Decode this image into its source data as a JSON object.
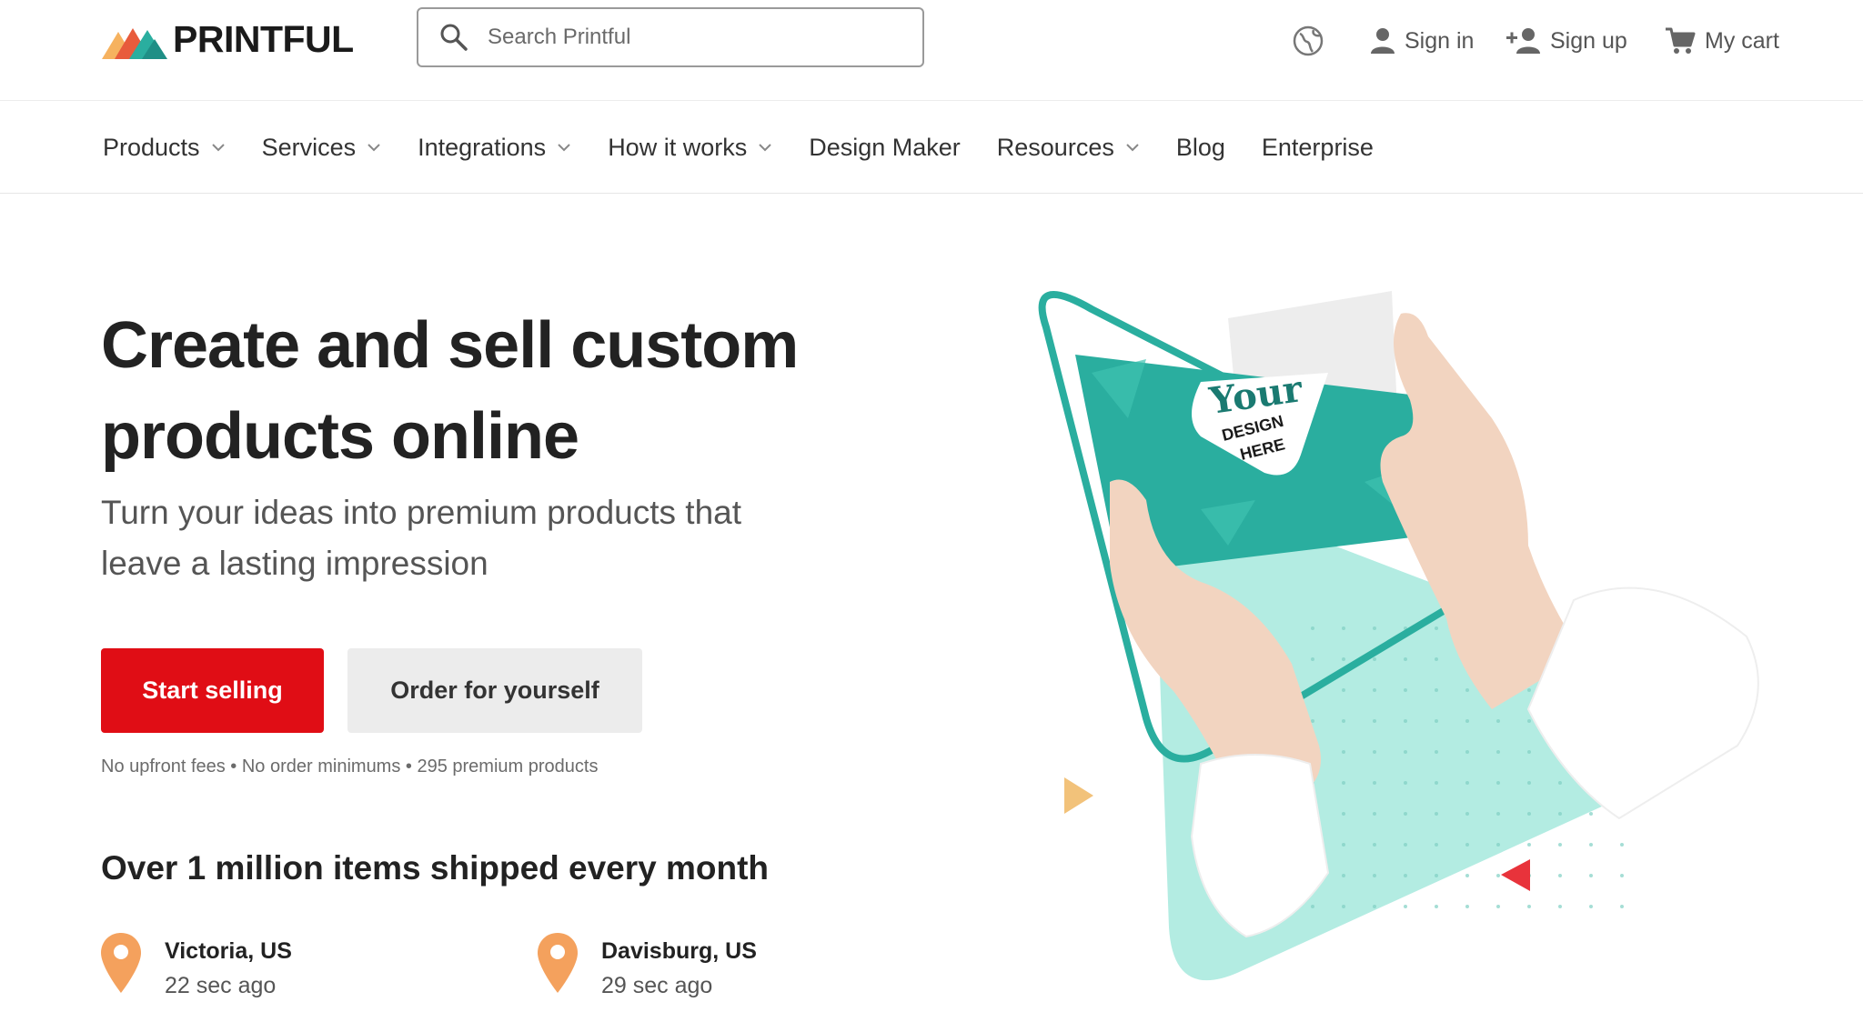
{
  "brand": {
    "name": "PRINTFUL",
    "colors": {
      "red": "#e00d15",
      "teal": "#2aae9f",
      "mint": "#a6e6dc",
      "orange": "#f4a15d",
      "gold": "#f2c27a"
    }
  },
  "search": {
    "placeholder": "Search Printful",
    "icon": "search-icon"
  },
  "header": {
    "globe_icon": "globe-icon",
    "sign_in": "Sign in",
    "sign_up": "Sign up",
    "cart": "My cart"
  },
  "nav": {
    "items": [
      {
        "label": "Products",
        "dropdown": true
      },
      {
        "label": "Services",
        "dropdown": true
      },
      {
        "label": "Integrations",
        "dropdown": true
      },
      {
        "label": "How it works",
        "dropdown": true
      },
      {
        "label": "Design Maker",
        "dropdown": false
      },
      {
        "label": "Resources",
        "dropdown": true
      },
      {
        "label": "Blog",
        "dropdown": false
      },
      {
        "label": "Enterprise",
        "dropdown": false
      }
    ]
  },
  "hero": {
    "title_line1": "Create and sell custom",
    "title_line2": "products online",
    "subtitle_line1": "Turn your ideas into premium products that",
    "subtitle_line2": "leave a lasting impression",
    "primary_cta": "Start selling",
    "secondary_cta": "Order for yourself",
    "fine_print": "No upfront fees • No order minimums • 295 premium products"
  },
  "shipping": {
    "heading": "Over 1 million items shipped every month",
    "locations": [
      {
        "place": "Victoria, US",
        "ago": "22 sec ago"
      },
      {
        "place": "Davisburg, US",
        "ago": "29 sec ago"
      }
    ]
  },
  "illustration": {
    "card_text_1": "Your",
    "card_text_2": "DESIGN",
    "card_text_3": "HERE"
  }
}
